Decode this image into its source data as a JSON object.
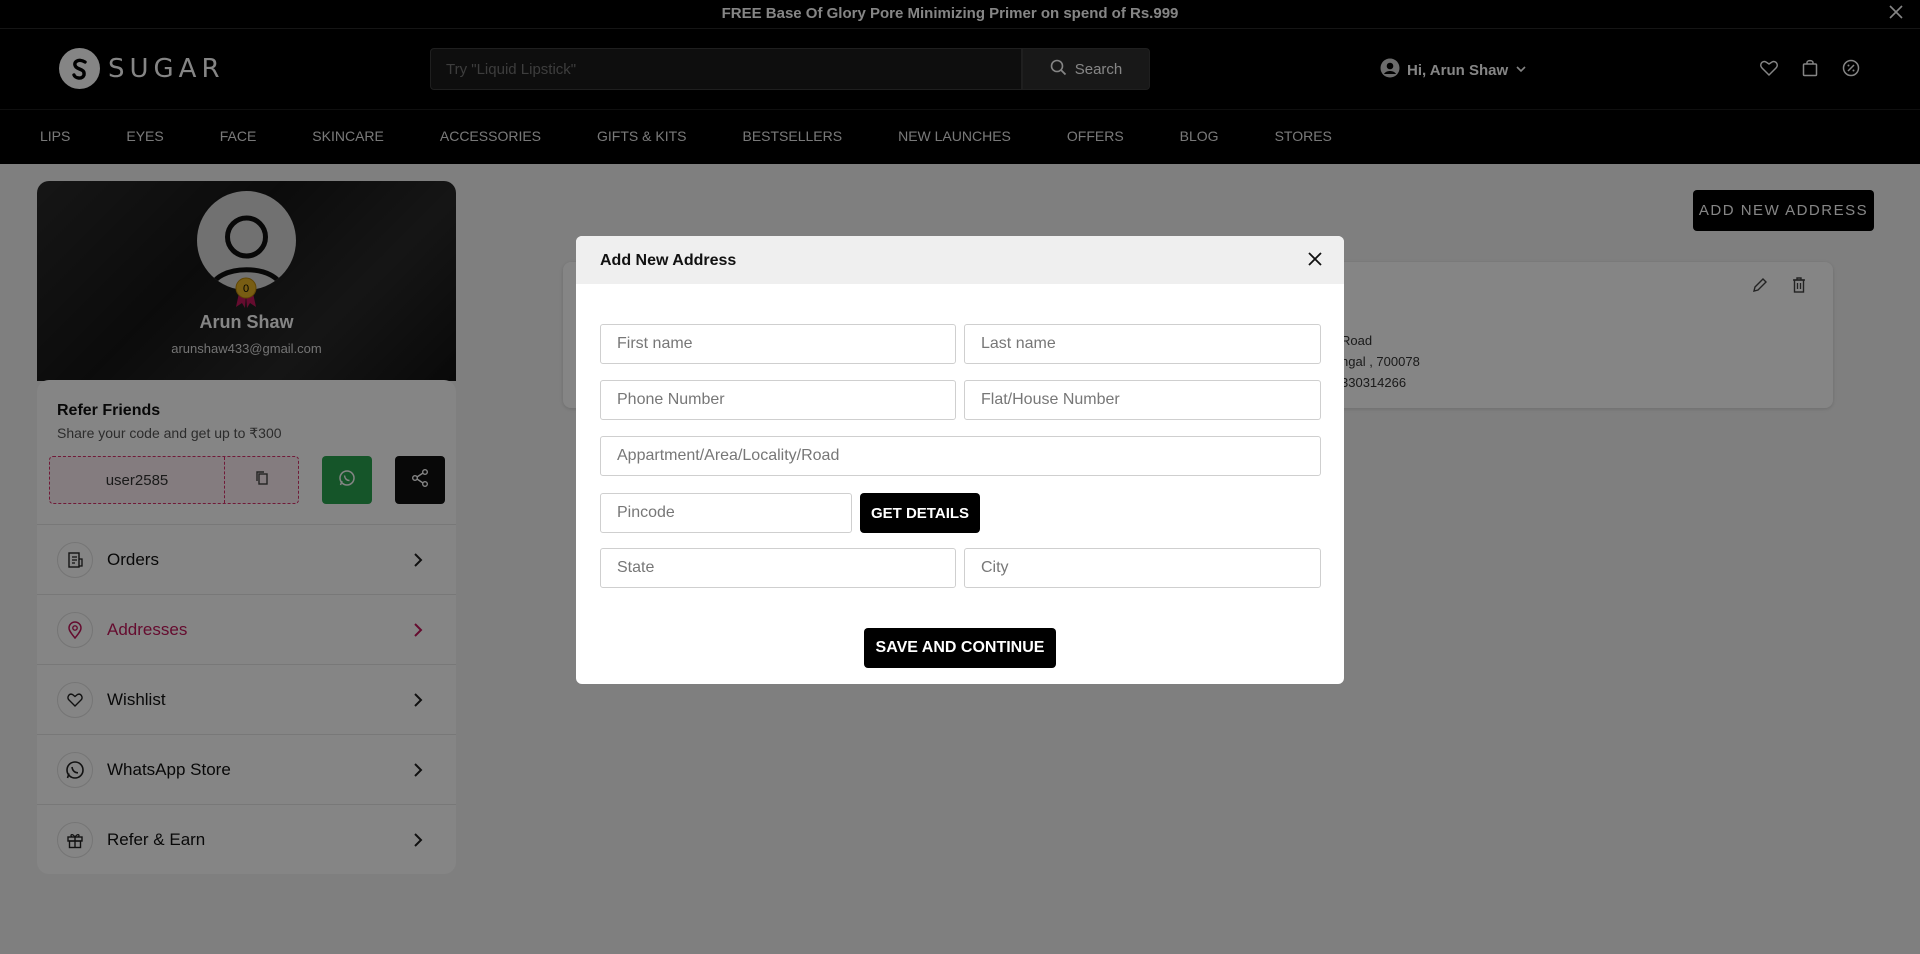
{
  "announcement": {
    "text": "FREE Base Of Glory Pore Minimizing Primer on spend of Rs.999"
  },
  "header": {
    "brand": "SUGAR",
    "search_placeholder": "Try \"Liquid Lipstick\"",
    "search_button": "Search",
    "greeting": "Hi, Arun Shaw",
    "icons": [
      "heart-icon",
      "bag-icon",
      "offer-icon"
    ]
  },
  "category_nav": [
    "LIPS",
    "EYES",
    "FACE",
    "SKINCARE",
    "ACCESSORIES",
    "GIFTS & KITS",
    "BESTSELLERS",
    "NEW LAUNCHES",
    "OFFERS",
    "BLOG",
    "STORES"
  ],
  "profile": {
    "name": "Arun Shaw",
    "email": "arunshaw433@gmail.com",
    "badge_count": "0"
  },
  "refer": {
    "title": "Refer Friends",
    "subtitle": "Share your code and get up to ₹300",
    "code": "user2585"
  },
  "menu": [
    {
      "label": "Orders",
      "icon": "orders-icon"
    },
    {
      "label": "Addresses",
      "icon": "location-pin-icon",
      "active": true
    },
    {
      "label": "Wishlist",
      "icon": "heart-icon"
    },
    {
      "label": "WhatsApp Store",
      "icon": "whatsapp-icon"
    },
    {
      "label": "Refer & Earn",
      "icon": "gift-icon"
    }
  ],
  "addresses": {
    "add_button": "ADD NEW ADDRESS",
    "card_lines": [
      "Road",
      "ngal , 700078",
      "330314266"
    ]
  },
  "modal": {
    "title": "Add New Address",
    "fields": {
      "first_name": "First name",
      "last_name": "Last name",
      "phone": "Phone Number",
      "flat": "Flat/House Number",
      "area": "Appartment/Area/Locality/Road",
      "pincode": "Pincode",
      "state": "State",
      "city": "City"
    },
    "get_details": "GET DETAILS",
    "save": "SAVE AND CONTINUE"
  },
  "colors": {
    "accent": "#c2185b",
    "whatsapp": "#2aa44f",
    "black": "#000000"
  }
}
